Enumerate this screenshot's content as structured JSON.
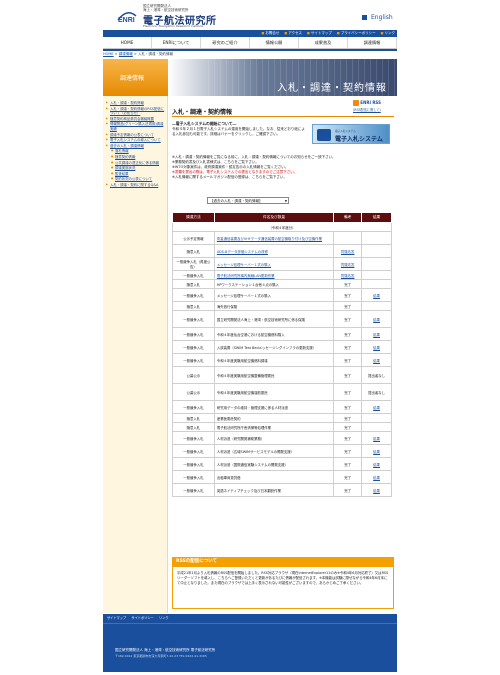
{
  "header": {
    "org_small_1": "国立研究開発法人",
    "org_small_2": "海上・港湾・航空技術研究所",
    "org_title": "電子航法研究所",
    "org_en": "Electronic Navigation Research Institute",
    "logo_text": "ENRI",
    "english_link": "English"
  },
  "utility": [
    "お問合せ",
    "アクセス",
    "サイトマップ",
    "プライバシーポリシー",
    "リンク"
  ],
  "nav": [
    "HOME",
    "ENRIについて",
    "研究のご紹介",
    "情報公開",
    "成果普及",
    "調達情報"
  ],
  "breadcrumb": {
    "home": "HOME",
    "mid": "調達情報",
    "current": "入札・調達・契約情報"
  },
  "side_header": "調達情報",
  "banner_text": "入札・調達・契約情報",
  "sidebar": [
    {
      "label": "入札・調達・契約情報",
      "sub": false
    },
    {
      "label": "入札・調達・契約情報のRSS配信について（お知らせ）",
      "sub": false
    },
    {
      "label": "随意契約検証委員会審議概要",
      "sub": false
    },
    {
      "label": "情報物品(グリーン購入法適用)調達実績",
      "sub": false
    },
    {
      "label": "調達予定情報の公表について",
      "sub": false
    },
    {
      "label": "電子入札システムの導入について",
      "sub": false
    },
    {
      "label": "過去の入札・調達情報",
      "sub": false
    },
    {
      "label": "落札情報",
      "sub": true
    },
    {
      "label": "随意契約情報",
      "sub": true
    },
    {
      "label": "公共調達の適正化に係る情報",
      "sub": true
    },
    {
      "label": "調達実施状況",
      "sub": true
    },
    {
      "label": "監査結果",
      "sub": true
    },
    {
      "label": "契約状況の公表について",
      "sub": true
    },
    {
      "label": "入札・調達・契約に関するQ&A",
      "sub": false
    }
  ],
  "rss": {
    "label": "ENRI RSS",
    "sub": "(RSS配信に関して)"
  },
  "title": "入札・調達・契約情報",
  "notice": {
    "head": "―電子入札システムの開始について―",
    "body": "令和４年２月１日電子入札システムの運用を開始しました。なお、従来どおり紙による入札参加も可能です。詳細はバナーをクリックし、ご確認下さい。"
  },
  "sys_banner": {
    "t1": "電子入札システム",
    "t2": "電子入札システム"
  },
  "info": [
    "※入札・調達・契約情報をご覧になる前に、入札・調達・契約情報についてのお知らせをご一読下さい。",
    "※業務契約書及び入札書様式は、こちらをご覧下さい。",
    "※WTO対象案件は、政府調達案件・暫定告示の入札情報をご覧ください。",
    "※書類を提出の際は、電子入札システムでの提出となりますのでご注意下さい。",
    "※入札情報に関するメールマガジン配信の登録は、こちらをご覧下さい。"
  ],
  "select_value": "【過去の入札・調達・契約情報】",
  "table": {
    "headers": [
      "調達方法",
      "件名及び数量",
      "備考",
      "結果"
    ],
    "year": "（令和４年度分）",
    "rows": [
      {
        "method": "公示予定情報",
        "item": "衛星通信装置及びVHFデータ通信装置の航空機取り付け及び空機作業",
        "note": "",
        "result": "",
        "link": true
      },
      {
        "method": "随意入札",
        "item": "ADS-Bデータ評価システムの改修",
        "note": "質疑応答",
        "result": "",
        "link": true
      },
      {
        "method": "一般競争入札（再度公告）",
        "item": "メッセージ処理サーバー１式の購入",
        "note": "質疑応答",
        "result": "",
        "link": true
      },
      {
        "method": "一般競争入札",
        "item": "電子航法研究所構内無線LAN更新作業",
        "note": "質疑応答",
        "result": "",
        "link": true
      },
      {
        "method": "随意入札",
        "item": "HPワークステーション１台他４点の購入",
        "note": "完了",
        "result": "",
        "link": false
      },
      {
        "method": "一般競争入札",
        "item": "メッセージ処理サーバー１式の購入",
        "note": "完了",
        "result": "結果",
        "link": false
      },
      {
        "method": "随意入札",
        "item": "海外旅行保険",
        "note": "完了",
        "result": "",
        "link": false
      },
      {
        "method": "一般競争入札",
        "item": "国立研究開発法人海上・港湾・航空技術研究所に係る保険",
        "note": "完了",
        "result": "結果",
        "link": false
      },
      {
        "method": "一般競争入札",
        "item": "令和４年度仙台空港における航空機燃料購入",
        "note": "完了",
        "result": "結果",
        "link": false
      },
      {
        "method": "一般競争入札",
        "item": "入試装置（SWIM Test Bedメッセージングインフラの更新支援）",
        "note": "完了",
        "result": "結果",
        "link": false
      },
      {
        "method": "一般競争入札",
        "item": "令和４年度実験用航空機燃料調達",
        "note": "完了",
        "result": "結果",
        "link": false
      },
      {
        "method": "公募公示",
        "item": "令和４年度実験用航空機整備管理委託",
        "note": "完了",
        "result": "提出者なし",
        "link": false
      },
      {
        "method": "公募公示",
        "item": "令和４年度実験用航空機運航委託",
        "note": "完了",
        "result": "提出者なし",
        "link": false
      },
      {
        "method": "一般競争入札",
        "item": "研究用データの維持・管理支援に係る人材派遣",
        "note": "完了",
        "result": "結果",
        "link": false
      },
      {
        "method": "随意入札",
        "item": "産業医委託契約",
        "note": "完了",
        "result": "",
        "link": false
      },
      {
        "method": "随意入札",
        "item": "電子航法研究所庁舎清掃等処理作業",
        "note": "完了",
        "result": "",
        "link": false
      },
      {
        "method": "一般競争入札",
        "item": "人材派遣（研究開発補助業務）",
        "note": "完了",
        "result": "結果",
        "link": false
      },
      {
        "method": "一般競争入札",
        "item": "人材派遣（広域SWIMサービスモデルの開発支援）",
        "note": "完了",
        "result": "結果",
        "link": false
      },
      {
        "method": "一般競争入札",
        "item": "人材派遣（国際通信実験システムの開発支援）",
        "note": "完了",
        "result": "結果",
        "link": false
      },
      {
        "method": "一般競争入札",
        "item": "出租車両賃貸借",
        "note": "完了",
        "result": "結果",
        "link": false
      },
      {
        "method": "一般競争入札",
        "item": "英語ネイティブチェック及び日本翻訳作業",
        "note": "完了",
        "result": "結果",
        "link": false
      }
    ]
  },
  "rss_section": {
    "head": "RSSの配信について",
    "body": "平成21年1月より入札情報のRSS配信を開始しました。RSS対応ブラウザ（現在InternetExplorer11のみ※令和4年6月対応終了）又はRSSリーダーソフトを導入し、こちらへご登録いただくと更新があるたびに情報が配信されます。※本機能は試験に際ぜながら令和4年6月末にて中止となりました。また現在のブラウザでは上手く表示されない可能性がございますので、あらかじめご了承ください。"
  },
  "footer_nav": [
    "サイトマップ",
    "サイトポリシー",
    "リンク"
  ],
  "footer": {
    "t1": "国立研究開発法人 海上・港湾・航空技術研究所 電子航法研究所",
    "t2": "〒182-0012 東京都調布市深大寺東町7-42-23  TEL:0422-41-3165"
  }
}
